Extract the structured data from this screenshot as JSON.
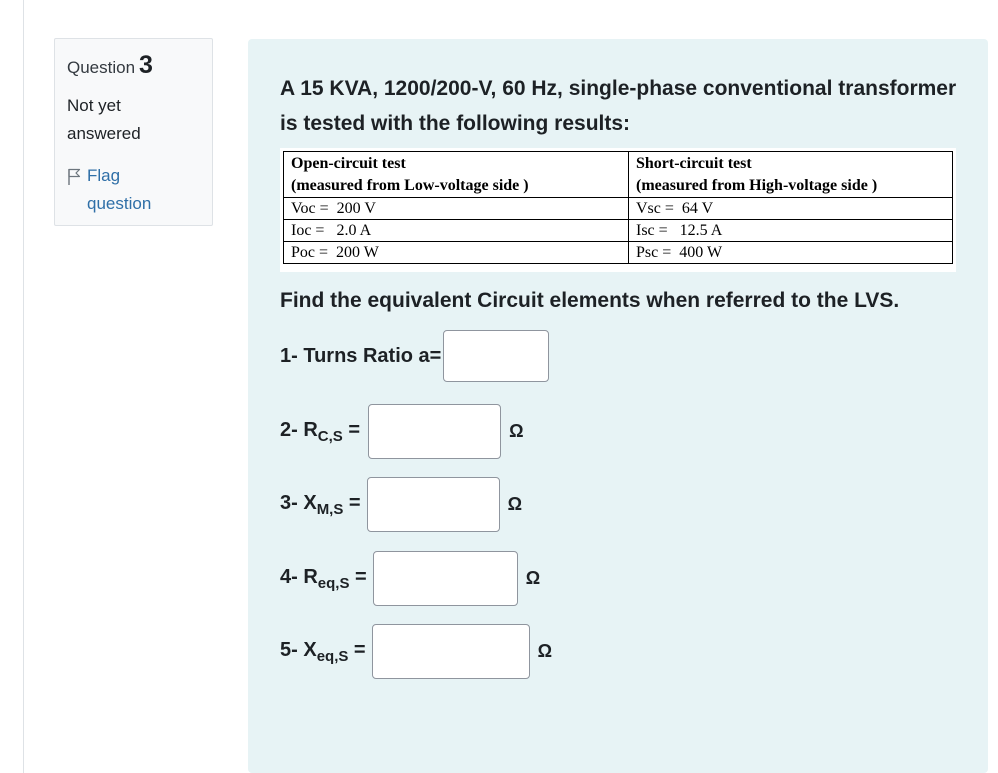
{
  "question": {
    "label": "Question",
    "number": "3",
    "state": "Not yet answered",
    "flag_label": "Flag question"
  },
  "problem": {
    "text": "A 15 KVA, 1200/200-V, 60 Hz, single-phase conventional transformer is tested with the following results:",
    "table": {
      "oc_header_1": "Open-circuit test",
      "oc_header_2": "(measured from Low-voltage side )",
      "sc_header_1": "Short-circuit test",
      "sc_header_2": "(measured from High-voltage side )",
      "rows": [
        {
          "oc": "Voc =  200 V",
          "sc": "Vsc =  64 V"
        },
        {
          "oc": "Ioc =   2.0 A",
          "sc": "Isc =   12.5 A"
        },
        {
          "oc": "Poc =  200 W",
          "sc": "Psc =  400 W"
        }
      ]
    },
    "instruction": "Find the equivalent Circuit elements when referred to the LVS."
  },
  "answers": [
    {
      "prefix": "1- Turns Ratio a=",
      "sym": "",
      "sub": "",
      "eq": "",
      "value": "",
      "unit": ""
    },
    {
      "prefix": "2- ",
      "sym": "R",
      "sub": "C,S",
      "eq": " =",
      "value": "",
      "unit": "Ω"
    },
    {
      "prefix": "3- ",
      "sym": "X",
      "sub": "M,S",
      "eq": " =",
      "value": "",
      "unit": "Ω"
    },
    {
      "prefix": "4- ",
      "sym": "R",
      "sub": "eq,S",
      "eq": " =",
      "value": "",
      "unit": "Ω"
    },
    {
      "prefix": "5- ",
      "sym": "X",
      "sub": "eq,S",
      "eq": " =",
      "value": "",
      "unit": "Ω"
    }
  ],
  "colors": {
    "info_bg": "#f8f9fa",
    "content_bg": "#e7f3f5",
    "link": "#2f6fa7",
    "text": "#1d2125"
  }
}
